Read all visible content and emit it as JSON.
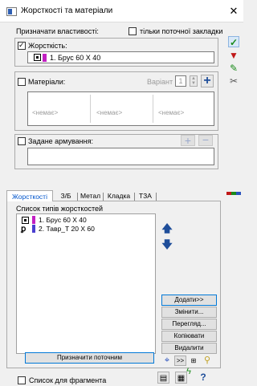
{
  "window": {
    "title": "Жорсткості та матеріали",
    "close_glyph": "✕"
  },
  "assign": {
    "label": "Призначати властивості:",
    "current_tab_only": "тільки поточної закладки",
    "stiffness_label": "Жорсткість:",
    "stiffness_value": "1. Брус 60 X 40",
    "materials_label": "Матеріали:",
    "variant_label": "Варіант",
    "variant_value": "1",
    "none_values": [
      "<немає>",
      "<немає>",
      "<немає>"
    ],
    "reinforcement_label": "Задане армування:"
  },
  "tabs": [
    "Жорсткості",
    "З/Б",
    "Метал",
    "Кладка",
    "ТЗА"
  ],
  "list": {
    "header": "Список типів жорсткостей",
    "items": [
      {
        "label": "1. Брус 60 X 40",
        "color": "#c21fc2"
      },
      {
        "label": "2. Тавр_Т 20 X 60",
        "color": "#4a3fd0"
      }
    ]
  },
  "buttons": {
    "add": "Додати>>",
    "change": "Змінити...",
    "view": "Перегляд...",
    "copy": "Копіювати",
    "delete": "Видалити",
    "assign_current": "Призначити поточним",
    "double_arrow": ">>"
  },
  "footer": {
    "fragment_list": "Список для фрагмента",
    "help": "?"
  },
  "colors": {
    "accent": "#0078d7",
    "ok_green": "#1a8a1a",
    "filter_red": "#c01818"
  }
}
